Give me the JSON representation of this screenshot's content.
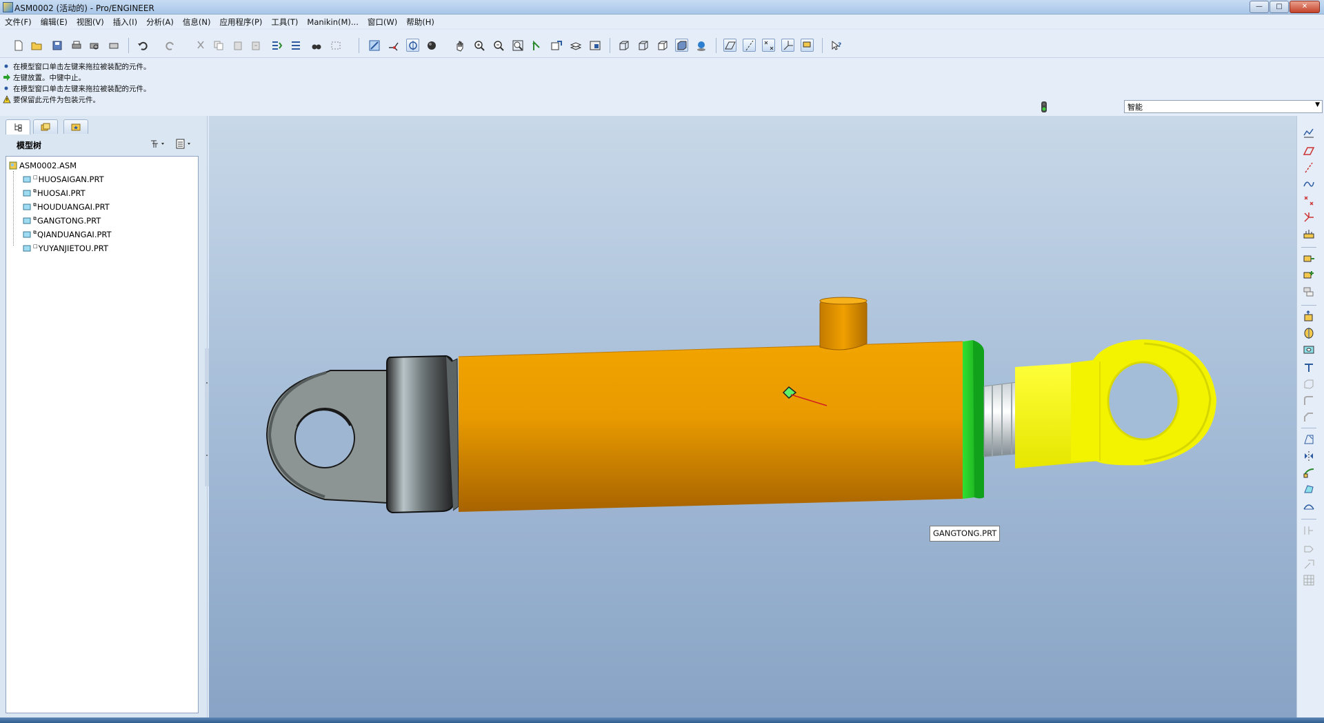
{
  "window": {
    "title": "ASM0002 (活动的) - Pro/ENGINEER",
    "buttons": {
      "min": "—",
      "max": "□",
      "close": "✕"
    }
  },
  "menu": [
    "文件(F)",
    "编辑(E)",
    "视图(V)",
    "插入(I)",
    "分析(A)",
    "信息(N)",
    "应用程序(P)",
    "工具(T)",
    "Manikin(M)...",
    "窗口(W)",
    "帮助(H)"
  ],
  "messages": [
    {
      "icon": "info-dot-icon",
      "text": "在模型窗口单击左键来拖拉被装配的元件。"
    },
    {
      "icon": "prompt-arrow-icon",
      "text": "左键放置。中键中止。"
    },
    {
      "icon": "info-dot-icon",
      "text": "在模型窗口单击左键来拖拉被装配的元件。"
    },
    {
      "icon": "warning-icon",
      "text": "要保留此元件为包装元件。"
    }
  ],
  "filter": {
    "value": "智能"
  },
  "model_tree": {
    "title": "模型树",
    "root": "ASM0002.ASM",
    "items": [
      "HUOSAIGAN.PRT",
      "HUOSAI.PRT",
      "HOUDUANGAI.PRT",
      "GANGTONG.PRT",
      "QIANDUANGAI.PRT",
      "YUYANJIETOU.PRT"
    ]
  },
  "viewport": {
    "tag_label": "GANGTONG.PRT"
  },
  "colors": {
    "cylinder": "#e38f00",
    "rod_end": "#ffff00",
    "seal_ring": "#22c82b",
    "clevis": "#8c9593",
    "background_top": "#c8d8e8"
  }
}
